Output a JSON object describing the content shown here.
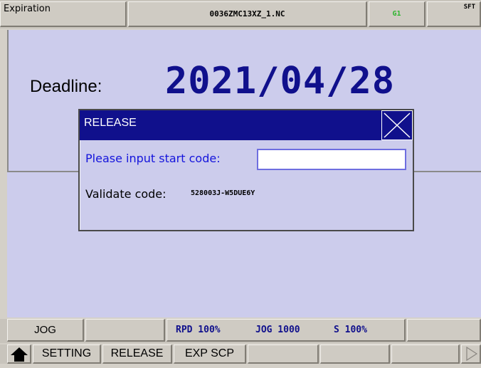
{
  "topbar": {
    "title": "Expiration",
    "filename": "0036ZMC13XZ_1.NC",
    "indicator": "G1",
    "sft": "SFT"
  },
  "main": {
    "deadline_label": "Deadline:",
    "deadline_value": "2021/04/28"
  },
  "dialog": {
    "title": "RELEASE",
    "prompt": "Please input start code:",
    "input_value": "",
    "validate_label": "Validate code:",
    "validate_code": "528003J-W5DUE6Y"
  },
  "status": {
    "mode": "JOG",
    "rapid": "RPD 100%",
    "jog": "JOG 1000",
    "spindle": "S 100%"
  },
  "softkeys": {
    "home_icon": "home-up-icon",
    "items": [
      "SETTING",
      "RELEASE",
      "EXP SCP",
      "",
      "",
      "",
      ""
    ],
    "next_icon": "next-arrow-icon"
  },
  "colors": {
    "accent": "#10108c",
    "prompt": "#1414dc",
    "background": "#ccccec",
    "indicator": "#2fb52f"
  }
}
